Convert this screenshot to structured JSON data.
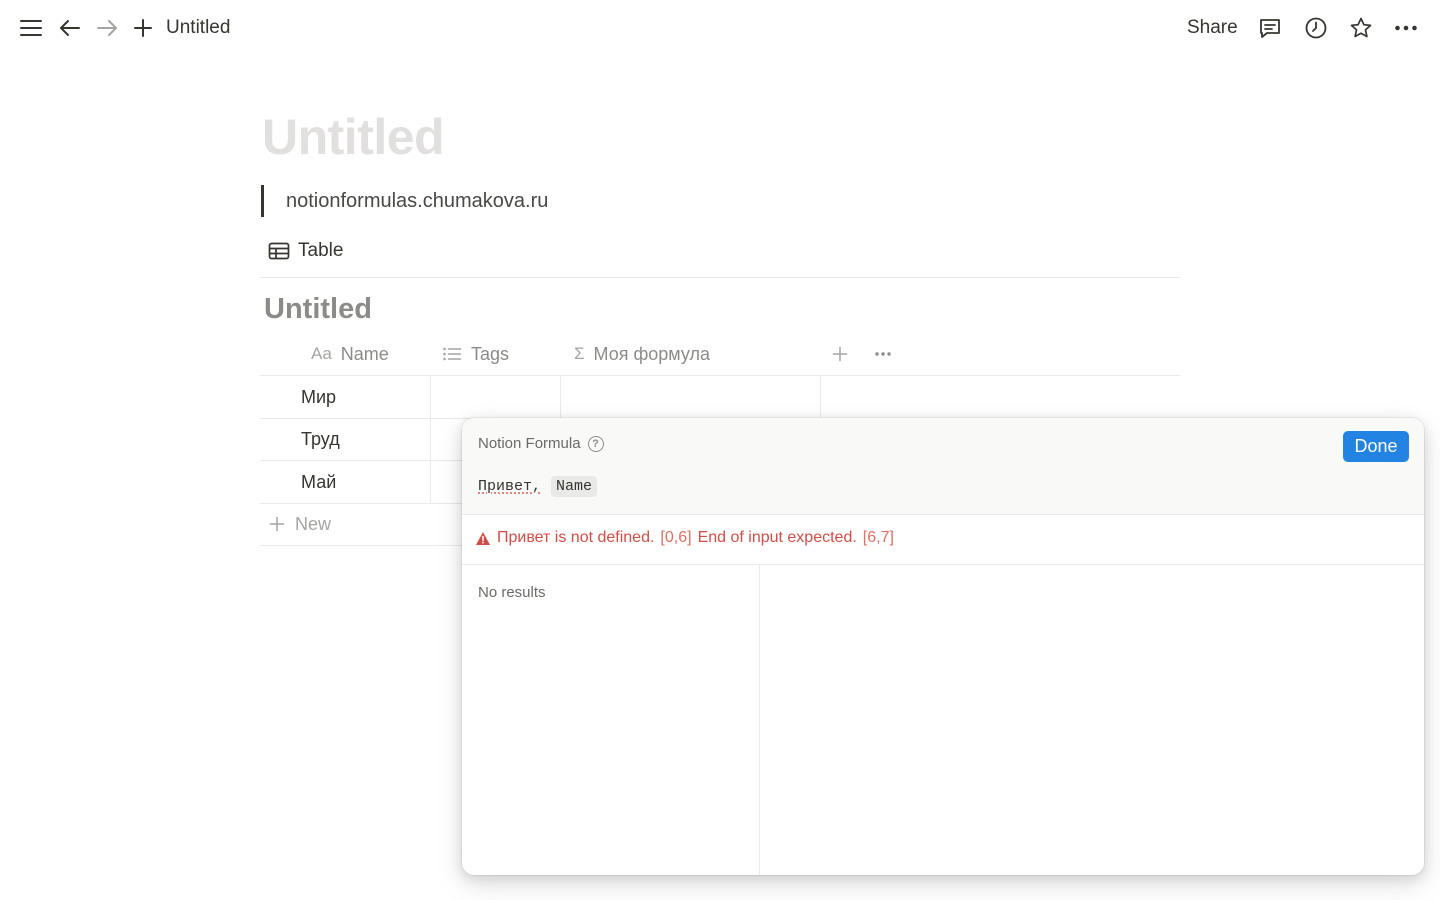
{
  "topbar": {
    "breadcrumb_title": "Untitled",
    "share_label": "Share"
  },
  "page": {
    "title": "Untitled",
    "quote": "notionformulas.chumakova.ru"
  },
  "view": {
    "tab_label": "Table"
  },
  "database": {
    "title": "Untitled",
    "columns": [
      {
        "icon": "Aa",
        "label": "Name"
      },
      {
        "icon": "list-icon",
        "label": "Tags"
      },
      {
        "icon": "Σ",
        "label": "Моя формула"
      }
    ],
    "rows": [
      {
        "name": "Мир"
      },
      {
        "name": "Труд"
      },
      {
        "name": "Май"
      }
    ],
    "new_label": "New"
  },
  "formula_popup": {
    "label": "Notion Formula",
    "help": "?",
    "done_label": "Done",
    "expression_word": "Привет,",
    "expression_token": "Name",
    "error_main_1": "Привет is not defined.",
    "error_pos_1": "[0,6]",
    "error_main_2": "End of input expected.",
    "error_pos_2": "[6,7]",
    "results_label": "No results"
  },
  "colors": {
    "accent": "#2383e2",
    "error": "#d44c47",
    "text": "#37352f",
    "muted": "#8c8b88"
  }
}
